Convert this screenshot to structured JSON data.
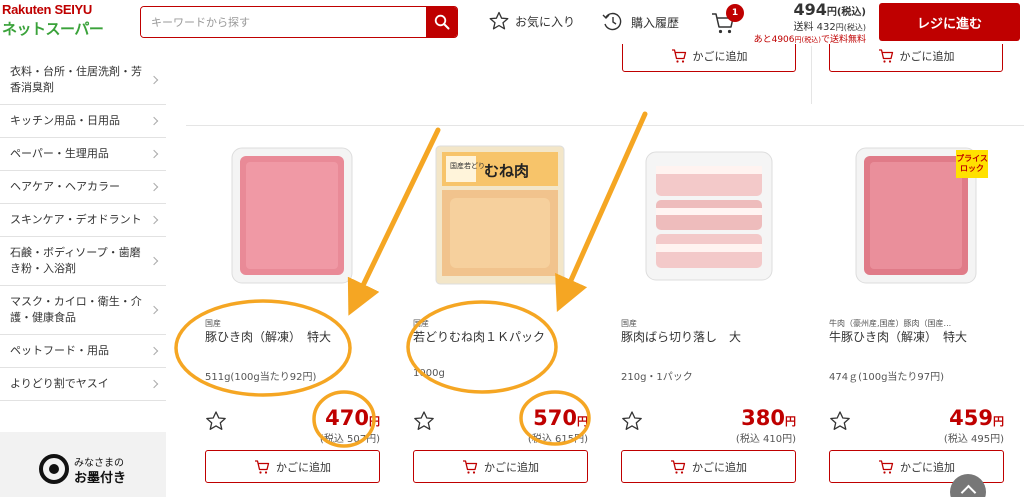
{
  "header": {
    "logo_line1": "Rakuten SEIYU",
    "logo_line2": "ネットスーパー",
    "search_placeholder": "キーワードから探す",
    "favorites": "お気に入り",
    "history": "購入履歴",
    "cart_count": "1",
    "cart_total": "494",
    "cart_total_suffix": "円(税込)",
    "shipping_label": "送料",
    "shipping_value": "432",
    "shipping_suffix": "円(税込)",
    "free_shipping_prefix": "あと4906",
    "free_shipping_small": "円(税込)",
    "free_shipping_suffix": "で送料無料",
    "checkout": "レジに進む"
  },
  "sidebar": {
    "items": [
      {
        "label": "衣料・台所・住居洗剤・芳香消臭剤"
      },
      {
        "label": "キッチン用品・日用品"
      },
      {
        "label": "ペーパー・生理用品"
      },
      {
        "label": "ヘアケア・ヘアカラー"
      },
      {
        "label": "スキンケア・デオドラント"
      },
      {
        "label": "石鹸・ボディソープ・歯磨き粉・入浴剤"
      },
      {
        "label": "マスク・カイロ・衛生・介護・健康食品"
      },
      {
        "label": "ペットフード・用品"
      },
      {
        "label": "よりどり割でヤスイ"
      }
    ],
    "banner_line1": "みなさまの",
    "banner_line2": "お墨付き"
  },
  "top_row": {
    "add_label": "かごに追加"
  },
  "products": [
    {
      "tag": "国産",
      "name": "豚ひき肉（解凍）　特大",
      "weight": "511g(100g当たり92円)",
      "price": "470",
      "yen": "円",
      "tax_price": "(税込 507円)",
      "add_label": "かごに追加"
    },
    {
      "tag": "国産",
      "name": "若どりむね肉１Ｋパック",
      "weight": "1000g",
      "price": "570",
      "yen": "円",
      "tax_price": "(税込 615円)",
      "add_label": "かごに追加",
      "package_text": "むね肉",
      "package_brand": "国産若どり"
    },
    {
      "tag": "国産",
      "name": "豚肉ばら切り落し　大",
      "weight": "210g・1パック",
      "price": "380",
      "yen": "円",
      "tax_price": "(税込 410円)",
      "add_label": "かごに追加"
    },
    {
      "tag": "牛肉（豪州産,国産）豚肉（国産...",
      "name": "牛豚ひき肉（解凍）　特大",
      "weight": "474ｇ(100g当たり97円)",
      "price": "459",
      "yen": "円",
      "tax_price": "(税込 495円)",
      "add_label": "かごに追加",
      "badge": "プライスロック"
    }
  ],
  "colors": {
    "brand_red": "#bf0000",
    "annotation_orange": "#f5a623",
    "logo_green": "#3aa23a"
  }
}
